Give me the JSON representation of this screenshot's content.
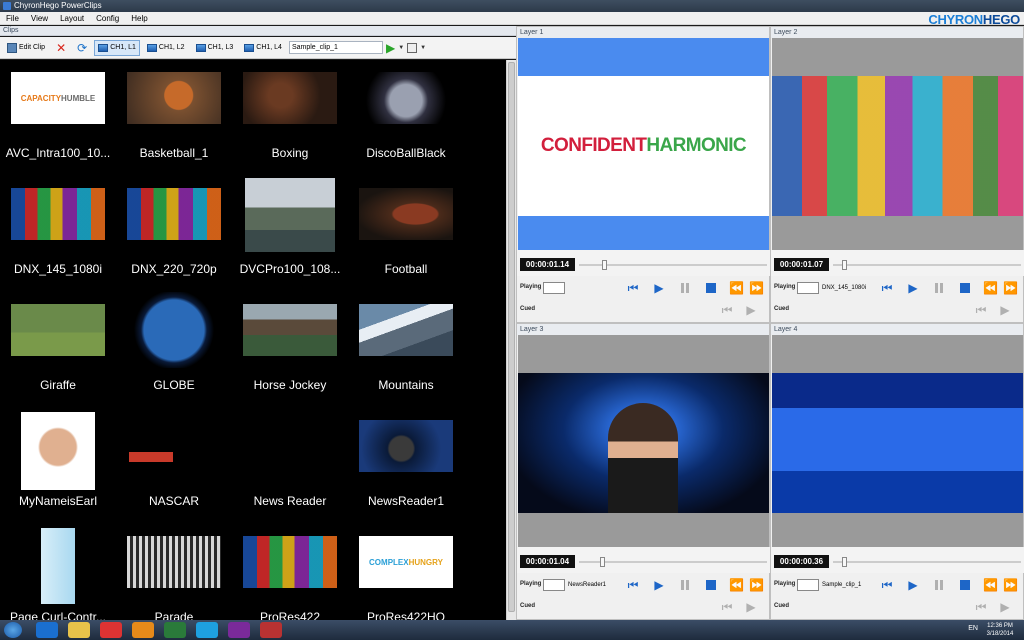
{
  "window": {
    "title": "ChyronHego PowerClips"
  },
  "menu": [
    "File",
    "View",
    "Layout",
    "Config",
    "Help"
  ],
  "brand": {
    "part1": "CHYRON",
    "part2": "HEGO"
  },
  "clips_panel": {
    "header": "Clips",
    "toolbar": {
      "edit_clip": "Edit Clip",
      "channels": [
        "CH1, L1",
        "CH1, L2",
        "CH1, L3",
        "CH1, L4"
      ],
      "clip_name": "Sample_clip_1"
    },
    "items": [
      {
        "label": "AVC_Intra100_10...",
        "thumb": "capacity-humble"
      },
      {
        "label": "Basketball_1",
        "thumb": "basketball"
      },
      {
        "label": "Boxing",
        "thumb": "boxing"
      },
      {
        "label": "DiscoBallBlack",
        "thumb": "discoball"
      },
      {
        "label": "DNX_145_1080i",
        "thumb": "letters"
      },
      {
        "label": "DNX_220_720p",
        "thumb": "letters"
      },
      {
        "label": "DVCPro100_108...",
        "thumb": "city"
      },
      {
        "label": "Football",
        "thumb": "football"
      },
      {
        "label": "Giraffe",
        "thumb": "giraffe"
      },
      {
        "label": "GLOBE",
        "thumb": "globe"
      },
      {
        "label": "Horse Jockey",
        "thumb": "horse"
      },
      {
        "label": "Mountains",
        "thumb": "mountains"
      },
      {
        "label": "MyNameisEarl",
        "thumb": "earl"
      },
      {
        "label": "NASCAR",
        "thumb": "nascar"
      },
      {
        "label": "News Reader",
        "thumb": "none"
      },
      {
        "label": "NewsReader1",
        "thumb": "newsreader"
      },
      {
        "label": "Page Curl-Contr...",
        "thumb": "pagecurl"
      },
      {
        "label": "Parade",
        "thumb": "parade"
      },
      {
        "label": "ProRes422",
        "thumb": "letters"
      },
      {
        "label": "ProRes422HQ",
        "thumb": "complex-hungry"
      }
    ],
    "thumb_text": {
      "capacity_a": "CAPACITY",
      "capacity_b": "HUMBLE",
      "complex_a": "COMPLEX",
      "complex_b": "HUNGRY"
    }
  },
  "layers": [
    {
      "title": "Layer 1",
      "timecode": "00:00:01.14",
      "playing_label": "Playing",
      "playing_clip": "",
      "cued_label": "Cued",
      "preview": "confident",
      "slider_pct": 0.12
    },
    {
      "title": "Layer 2",
      "timecode": "00:00:01.07",
      "playing_label": "Playing",
      "playing_clip": "DNX_145_1080i",
      "cued_label": "Cued",
      "preview": "letters-big",
      "slider_pct": 0.05
    },
    {
      "title": "Layer 3",
      "timecode": "00:00:01.04",
      "playing_label": "Playing",
      "playing_clip": "NewsReader1",
      "cued_label": "Cued",
      "preview": "anchor",
      "slider_pct": 0.11
    },
    {
      "title": "Layer 4",
      "timecode": "00:00:00.36",
      "playing_label": "Playing",
      "playing_clip": "Sample_clip_1",
      "cued_label": "Cued",
      "preview": "bluebg",
      "slider_pct": 0.05
    }
  ],
  "preview_text": {
    "confident_a": "CONFIDENT",
    "confident_b": "HARMONIC"
  },
  "taskbar": {
    "lang": "EN",
    "time": "12:36 PM",
    "date": "3/18/2014"
  },
  "colors": {
    "accent": "#1c7fd6",
    "clips_bg": "#000000",
    "confident_red": "#d21f3c",
    "harmonic_green": "#3aa64a",
    "layer1_blue": "#4a8bef"
  }
}
